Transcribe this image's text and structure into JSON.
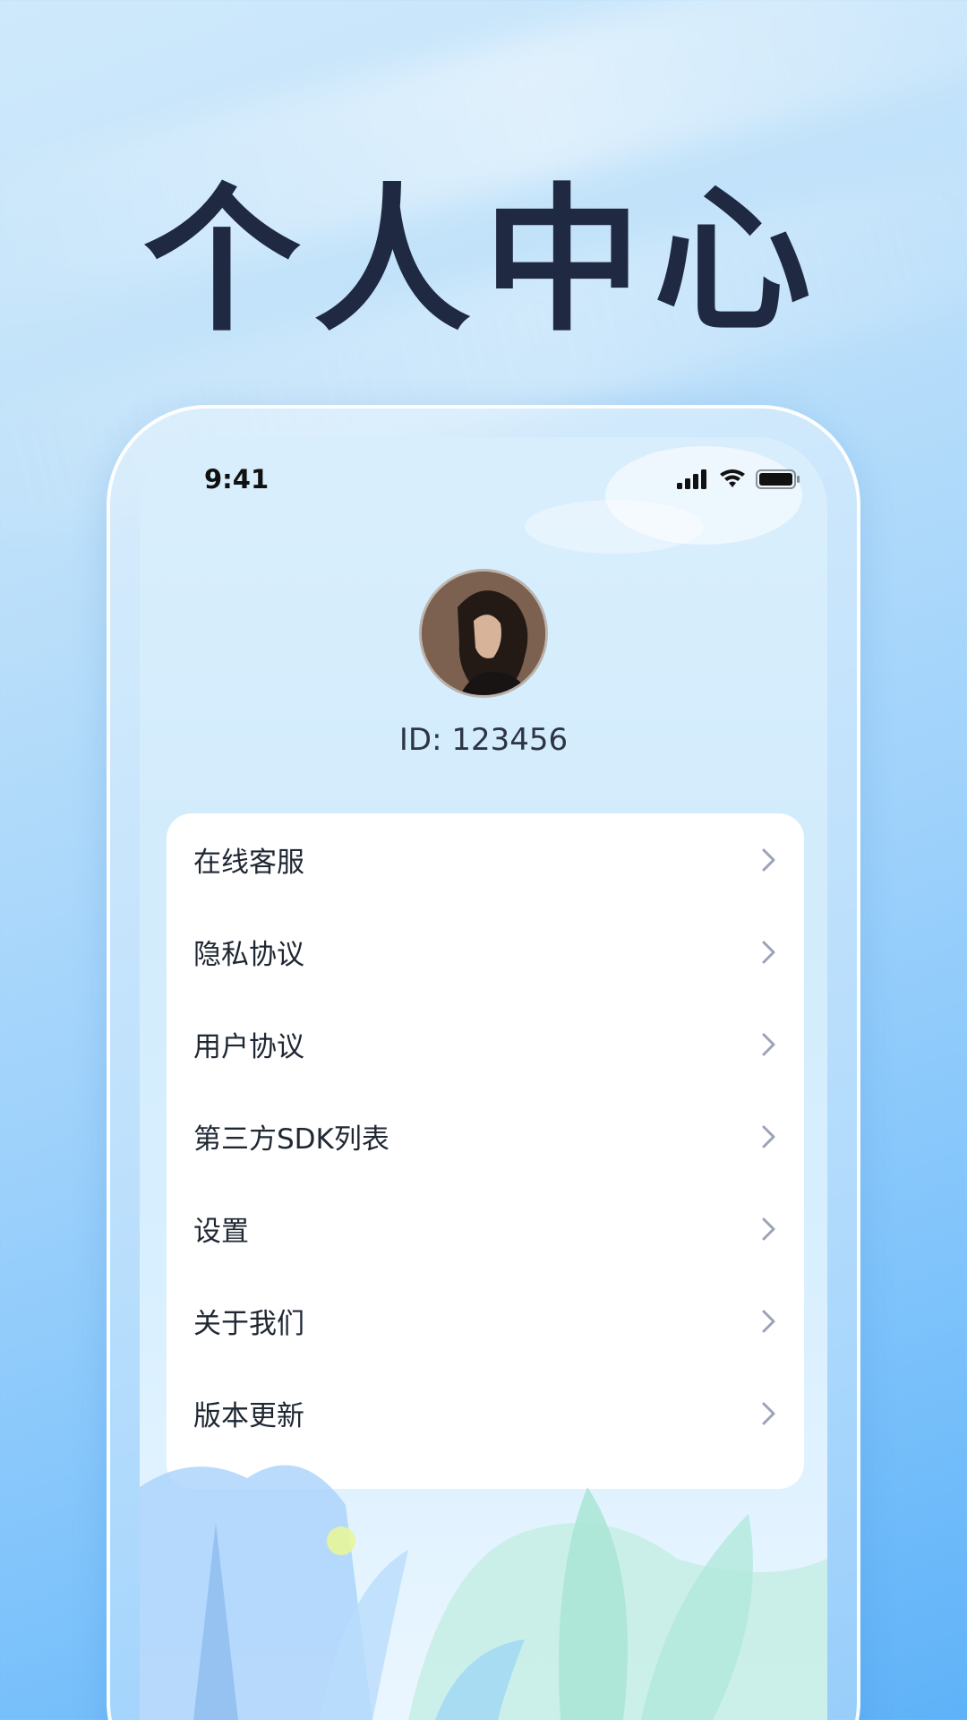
{
  "poster": {
    "title": "个人中心"
  },
  "status_bar": {
    "time": "9:41",
    "icons": [
      "cellular-signal-icon",
      "wifi-icon",
      "battery-icon"
    ]
  },
  "profile": {
    "avatar": "user-avatar-photo",
    "id_text": "ID: 123456"
  },
  "menu": {
    "items": [
      {
        "label": "在线客服",
        "icon": "chevron-right-icon"
      },
      {
        "label": "隐私协议",
        "icon": "chevron-right-icon"
      },
      {
        "label": "用户协议",
        "icon": "chevron-right-icon"
      },
      {
        "label": "第三方SDK列表",
        "icon": "chevron-right-icon"
      },
      {
        "label": "设置",
        "icon": "chevron-right-icon"
      },
      {
        "label": "关于我们",
        "icon": "chevron-right-icon"
      },
      {
        "label": "版本更新",
        "icon": "chevron-right-icon"
      }
    ]
  },
  "colors": {
    "title": "#1f2942",
    "card_bg": "#ffffff",
    "label": "#1f2733",
    "chevron": "#9aa3b8"
  }
}
